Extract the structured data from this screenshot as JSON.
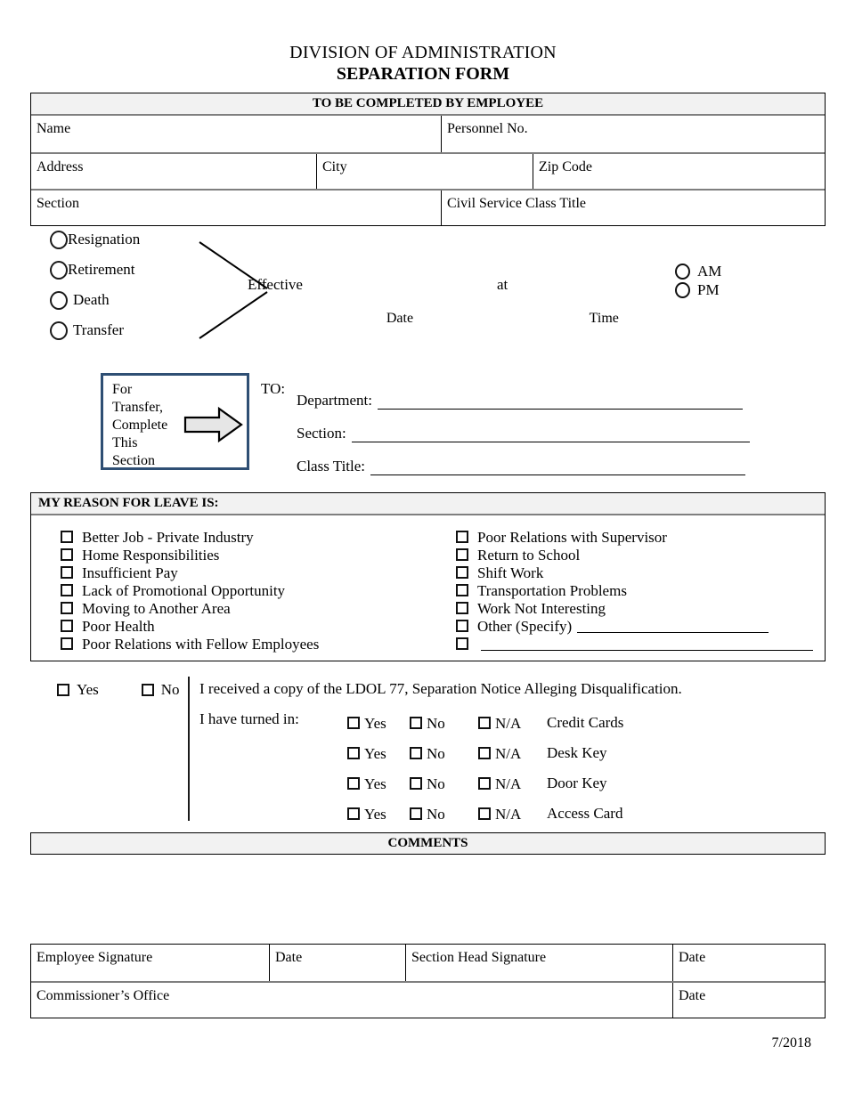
{
  "title": {
    "line1": "DIVISION OF ADMINISTRATION",
    "line2": "SEPARATION FORM"
  },
  "employee_section": {
    "header": "TO BE COMPLETED BY EMPLOYEE",
    "rows": [
      [
        "Name",
        "Personnel No."
      ],
      [
        "Address",
        "City",
        "Zip Code"
      ],
      [
        "Section",
        "Civil Service Class Title"
      ]
    ]
  },
  "separation": {
    "types": [
      "Resignation",
      "Retirement",
      "Death",
      "Transfer"
    ],
    "effective_label": "Effective",
    "at_label": "at",
    "date_caption": "Date",
    "time_caption": "Time",
    "am_label": "AM",
    "pm_label": "PM"
  },
  "transfer": {
    "box_text": "For Transfer, Complete This Section",
    "to_label": "TO:",
    "fields": [
      "Department:",
      "Section:",
      "Class Title:"
    ]
  },
  "reason": {
    "header": "MY REASON FOR LEAVE IS:",
    "left_options": [
      "Better Job - Private Industry",
      "Home Responsibilities",
      "Insufficient Pay",
      "Lack of Promotional Opportunity",
      "Moving to Another Area",
      "Poor Health",
      "Poor Relations with Fellow Employees"
    ],
    "right_options": [
      "Poor Relations with Supervisor",
      "Return to School",
      "Shift Work",
      "Transportation Problems",
      "Work Not Interesting",
      "Other (Specify)",
      ""
    ]
  },
  "ldol": {
    "yes_label": "Yes",
    "no_label": "No",
    "statement": "I received a copy of the LDOL 77, Separation Notice Alleging Disqualification.",
    "turned_in_label": "I have turned in:",
    "option_yes": "Yes",
    "option_no": "No",
    "option_na": "N/A",
    "items": [
      "Credit Cards",
      "Desk Key",
      "Door Key",
      "Access Card"
    ]
  },
  "comments": {
    "header": "COMMENTS"
  },
  "signatures": {
    "row1": [
      "Employee Signature",
      "Date",
      "Section Head Signature",
      "Date"
    ],
    "row2": [
      "Commissioner’s Office",
      "Date"
    ]
  },
  "footer": {
    "revision_date": "7/2018"
  },
  "colors": {
    "band_bg": "#f2f2f2",
    "band_border": "#7f7f7f",
    "transfer_border": "#2f4f74",
    "arrow_fill": "#e6e6e6"
  }
}
